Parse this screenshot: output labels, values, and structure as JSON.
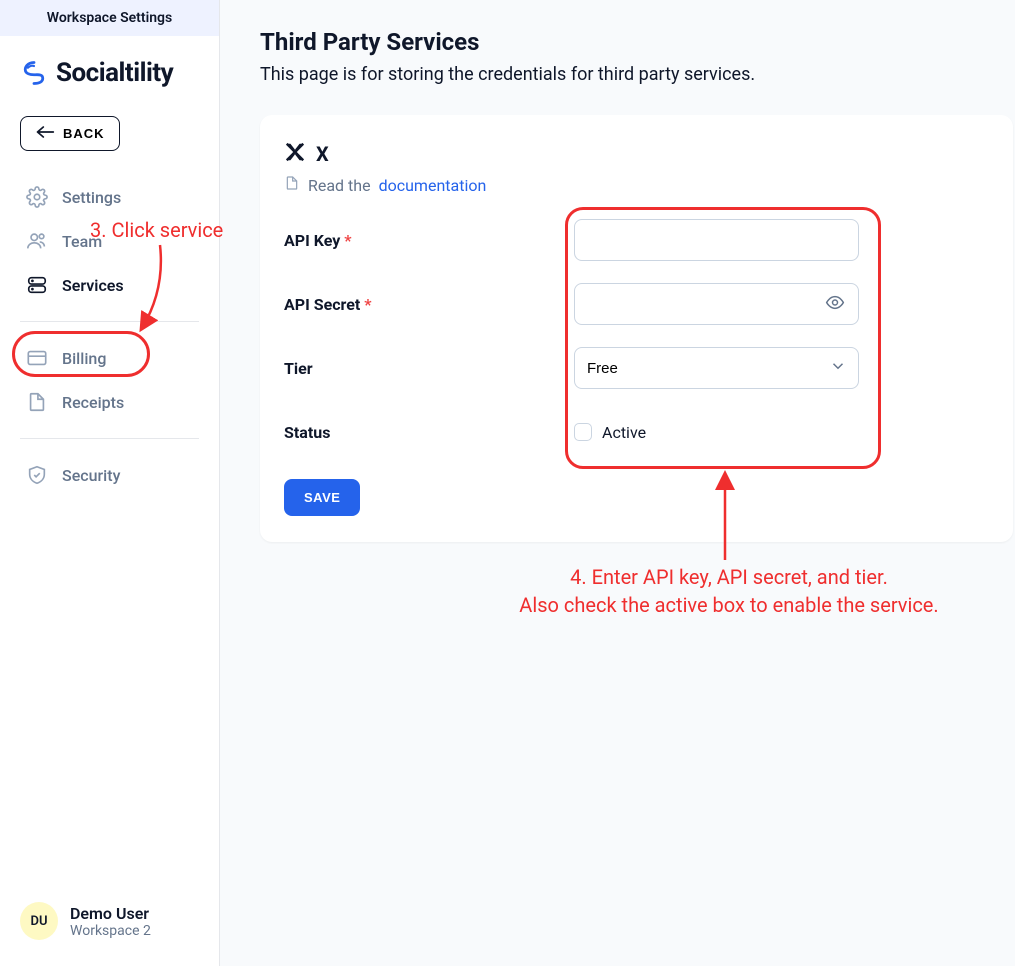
{
  "workspace_tab": "Workspace Settings",
  "brand": {
    "name": "Socialtility"
  },
  "back_label": "BACK",
  "nav": {
    "settings": "Settings",
    "team": "Team",
    "services": "Services",
    "billing": "Billing",
    "receipts": "Receipts",
    "security": "Security"
  },
  "user": {
    "initials": "DU",
    "name": "Demo User",
    "workspace": "Workspace 2"
  },
  "page": {
    "title": "Third Party Services",
    "subtitle": "This page is for storing the credentials for third party services."
  },
  "service": {
    "name": "X",
    "doc_prefix": "Read the ",
    "doc_link": "documentation",
    "fields": {
      "api_key_label": "API Key",
      "api_key_value": "",
      "api_secret_label": "API Secret",
      "api_secret_value": "",
      "tier_label": "Tier",
      "tier_value": "Free",
      "status_label": "Status",
      "active_label": "Active",
      "active_checked": false
    },
    "save_label": "SAVE"
  },
  "annotations": {
    "step3": "3. Click service",
    "step4_line1": "4. Enter API key, API secret, and tier.",
    "step4_line2": "Also check the active box to enable the service."
  }
}
